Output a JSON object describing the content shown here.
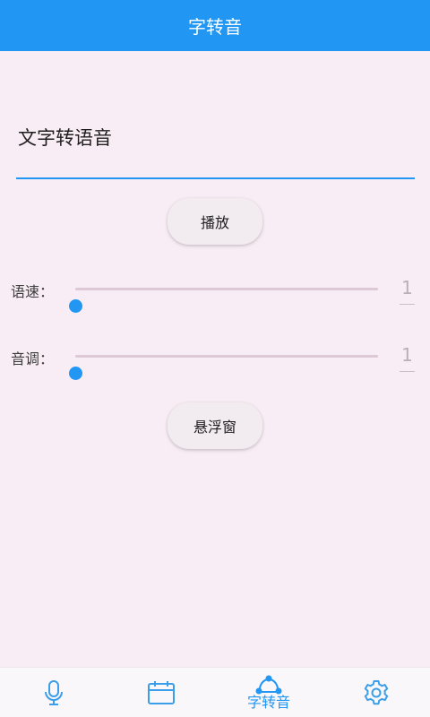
{
  "appbar": {
    "title": "字转音"
  },
  "editor": {
    "text": "文字转语音"
  },
  "buttons": {
    "play": "播放",
    "float_window": "悬浮窗"
  },
  "sliders": [
    {
      "label": "语速：",
      "value": "1",
      "fraction": 0
    },
    {
      "label": "音调：",
      "value": "1",
      "fraction": 0
    }
  ],
  "bottom_nav": {
    "items": [
      {
        "icon": "microphone-icon",
        "label": ""
      },
      {
        "icon": "calendar-icon",
        "label": ""
      },
      {
        "icon": "share-nodes-icon",
        "label": "字转音",
        "active": true
      },
      {
        "icon": "gear-icon",
        "label": ""
      }
    ]
  },
  "colors": {
    "primary": "#2196f3",
    "background": "#f9edf5",
    "icon_inactive": "#3b9ee8"
  }
}
